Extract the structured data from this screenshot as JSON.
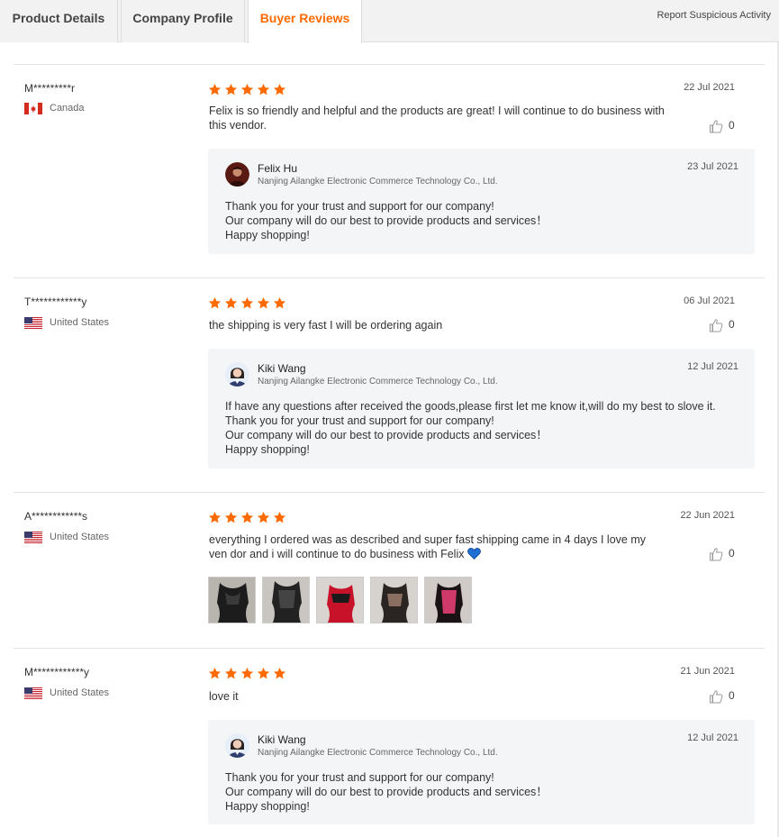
{
  "tabs": [
    {
      "label": "Product Details"
    },
    {
      "label": "Company Profile"
    },
    {
      "label": "Buyer Reviews",
      "active": true
    }
  ],
  "report_link": "Report Suspicious Activity",
  "colors": {
    "accent": "#ff6a00",
    "star": "#ff6a00",
    "reply_bg": "#f4f5f7"
  },
  "reviews": [
    {
      "buyer": "M*********r",
      "country": "Canada",
      "flag": "canada-flag-icon",
      "rating": 5,
      "date": "22 Jul 2021",
      "text": "Felix is so friendly and helpful and the products are great! I will continue to do business with this vendor.",
      "likes": "0",
      "reply": {
        "name": "Felix Hu",
        "company": "Nanjing Ailangke Electronic Commerce Technology Co., Ltd.",
        "date": "23 Jul 2021",
        "lines": [
          "Thank you for your trust and support for our company!",
          "Our company will do our best to provide products and services！",
          "Happy shopping!"
        ]
      }
    },
    {
      "buyer": "T************y",
      "country": "United States",
      "flag": "us-flag-icon",
      "rating": 5,
      "date": "06 Jul 2021",
      "text": "the shipping is very fast I will be ordering again",
      "likes": "0",
      "reply": {
        "name": "Kiki Wang",
        "company": "Nanjing Ailangke Electronic Commerce Technology Co., Ltd.",
        "date": "12 Jul 2021",
        "lines": [
          "If have any questions after received the goods,please first let me know it,will do my best to slove it.",
          "Thank you for your trust and support for our company!",
          "Our company will do our best to provide products and services！",
          "Happy shopping!"
        ]
      }
    },
    {
      "buyer": "A************s",
      "country": "United States",
      "flag": "us-flag-icon",
      "rating": 5,
      "date": "22 Jun 2021",
      "text": "everything I ordered was as described and super fast shipping came in 4 days I love my ven dor and i will continue to do business with Felix",
      "text_emoji": "blue-heart-icon",
      "likes": "0",
      "photos": [
        "review-photo",
        "review-photo",
        "review-photo",
        "review-photo",
        "review-photo"
      ]
    },
    {
      "buyer": "M************y",
      "country": "United States",
      "flag": "us-flag-icon",
      "rating": 5,
      "date": "21 Jun 2021",
      "text": "love it",
      "likes": "0",
      "reply": {
        "name": "Kiki Wang",
        "company": "Nanjing Ailangke Electronic Commerce Technology Co., Ltd.",
        "date": "12 Jul 2021",
        "lines": [
          "Thank you for your trust and support for our company!",
          "Our company will do our best to provide products and services！",
          "Happy shopping!"
        ]
      }
    }
  ]
}
